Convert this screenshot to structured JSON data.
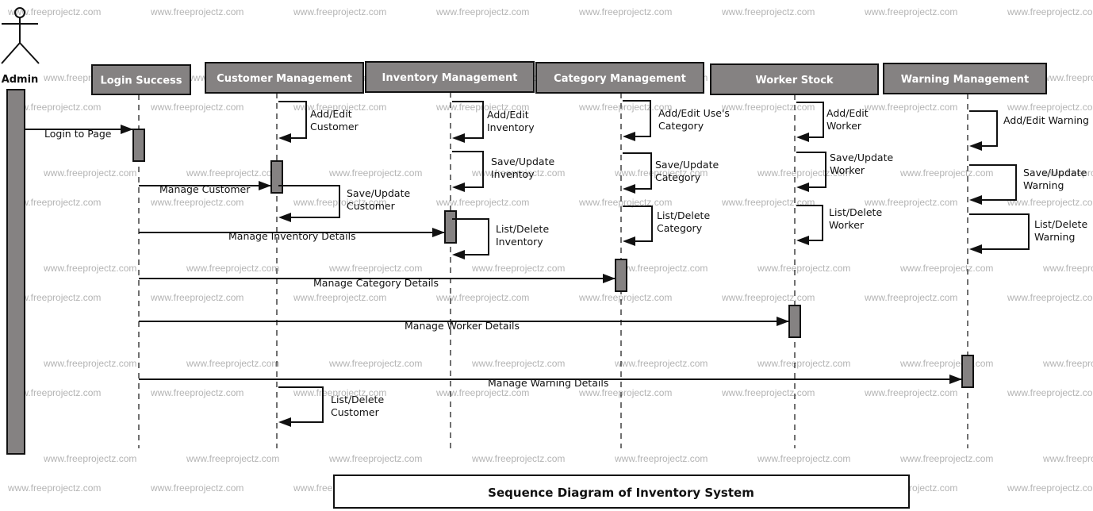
{
  "watermark": "www.freeprojectz.com",
  "title": "Sequence Diagram of Inventory System",
  "actor": {
    "id": "admin",
    "label": "Admin"
  },
  "participants": [
    {
      "id": "login",
      "label": "Login Success"
    },
    {
      "id": "customer",
      "label": "Customer Management"
    },
    {
      "id": "inventory",
      "label": "Inventory Management"
    },
    {
      "id": "category",
      "label": "Category Management"
    },
    {
      "id": "worker",
      "label": "Worker Stock"
    },
    {
      "id": "warning",
      "label": "Warning Management"
    }
  ],
  "messages": [
    {
      "from": "admin",
      "to": "login",
      "label": "Login to Page"
    },
    {
      "from": "login",
      "to": "customer",
      "label": "Manage Customer"
    },
    {
      "from": "login",
      "to": "inventory",
      "label": "Manage Inventory Details"
    },
    {
      "from": "login",
      "to": "category",
      "label": "Manage Category Details"
    },
    {
      "from": "login",
      "to": "worker",
      "label": "Manage Worker Details"
    },
    {
      "from": "login",
      "to": "warning",
      "label": "Manage Warning Details"
    }
  ],
  "self_messages": [
    {
      "on": "customer",
      "label": [
        "Add/Edit",
        "Customer"
      ]
    },
    {
      "on": "customer",
      "label": [
        "Save/Update",
        "Customer"
      ]
    },
    {
      "on": "customer",
      "label": [
        "List/Delete",
        "Customer"
      ]
    },
    {
      "on": "inventory",
      "label": [
        "Add/Edit",
        "Inventory"
      ]
    },
    {
      "on": "inventory",
      "label": [
        "Save/Update",
        "Inventoy"
      ]
    },
    {
      "on": "inventory",
      "label": [
        "List/Delete",
        "Inventory"
      ]
    },
    {
      "on": "category",
      "label": [
        "Add/Edit Use's",
        "Category"
      ]
    },
    {
      "on": "category",
      "label": [
        "Save/Update",
        "Category"
      ]
    },
    {
      "on": "category",
      "label": [
        "List/Delete",
        "Category"
      ]
    },
    {
      "on": "worker",
      "label": [
        "Add/Edit",
        "Worker"
      ]
    },
    {
      "on": "worker",
      "label": [
        "Save/Update",
        "Worker"
      ]
    },
    {
      "on": "worker",
      "label": [
        "List/Delete",
        "Worker"
      ]
    },
    {
      "on": "warning",
      "label": [
        "Add/Edit Warning"
      ]
    },
    {
      "on": "warning",
      "label": [
        "Save/Update",
        "Warning"
      ]
    },
    {
      "on": "warning",
      "label": [
        "List/Delete",
        "Warning"
      ]
    }
  ]
}
